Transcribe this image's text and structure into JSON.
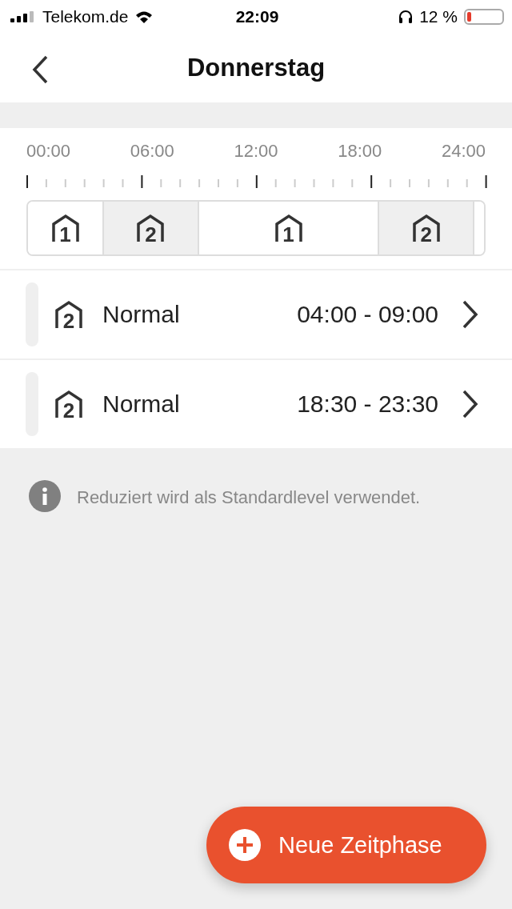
{
  "status_bar": {
    "carrier": "Telekom.de",
    "time": "22:09",
    "battery_text": "12 %",
    "battery": {
      "level": 0.12
    }
  },
  "nav": {
    "title": "Donnerstag"
  },
  "timeline": {
    "labels": [
      "00:00",
      "06:00",
      "12:00",
      "18:00",
      "24:00"
    ],
    "segments": [
      {
        "kind": "reduced",
        "mode": "1"
      },
      {
        "kind": "normal",
        "mode": "2"
      },
      {
        "kind": "reduced",
        "mode": "1"
      },
      {
        "kind": "normal",
        "mode": "2"
      },
      {
        "kind": "reduced"
      }
    ]
  },
  "phases": [
    {
      "mode": "2",
      "name": "Normal",
      "time": "04:00 - 09:00"
    },
    {
      "mode": "2",
      "name": "Normal",
      "time": "18:30 - 23:30"
    }
  ],
  "info": "Reduziert wird als Standardlevel verwendet.",
  "fab": {
    "label": "Neue Zeitphase"
  }
}
